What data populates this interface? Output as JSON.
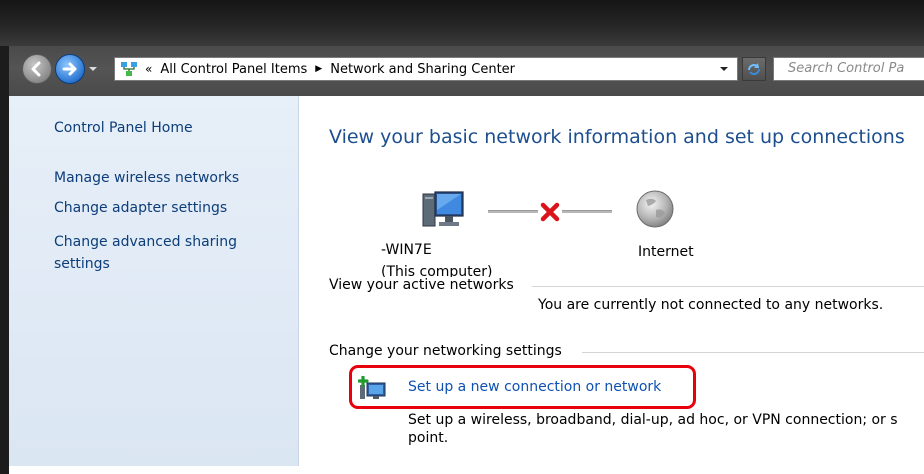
{
  "window": {
    "accent": "#1d4f8f"
  },
  "address_bar": {
    "overflow_chevron": "«",
    "segments": [
      "All Control Panel Items",
      "Network and Sharing Center"
    ],
    "separator": "▶"
  },
  "search": {
    "placeholder": "Search Control Pa"
  },
  "left_pane": {
    "home": "Control Panel Home",
    "items": [
      "Manage wireless networks",
      "Change adapter settings",
      "Change advanced sharing settings"
    ]
  },
  "main": {
    "title": "View your basic network information and set up connections",
    "network_map": {
      "computer_name": "-WIN7E",
      "computer_sub": "(This computer)",
      "internet_label": "Internet",
      "status": "disconnected"
    },
    "active_networks": {
      "label": "View your active networks",
      "status": "You are currently not connected to any networks."
    },
    "settings": {
      "label": "Change your networking settings",
      "setup_link": "Set up a new connection or network",
      "setup_desc_line1": "Set up a wireless, broadband, dial-up, ad hoc, or VPN connection; or s",
      "setup_desc_line2": "point."
    }
  },
  "icons": {
    "back": "back-arrow-icon",
    "forward": "forward-arrow-icon",
    "address": "network-control-panel-icon",
    "refresh": "refresh-icon",
    "computer": "computer-icon",
    "disconnected": "red-x-icon",
    "internet": "globe-icon",
    "setup": "new-connection-icon"
  },
  "colors": {
    "link": "#0e52b3",
    "highlight_box": "#e8000d",
    "nav_bg": "#dfe9f5"
  }
}
